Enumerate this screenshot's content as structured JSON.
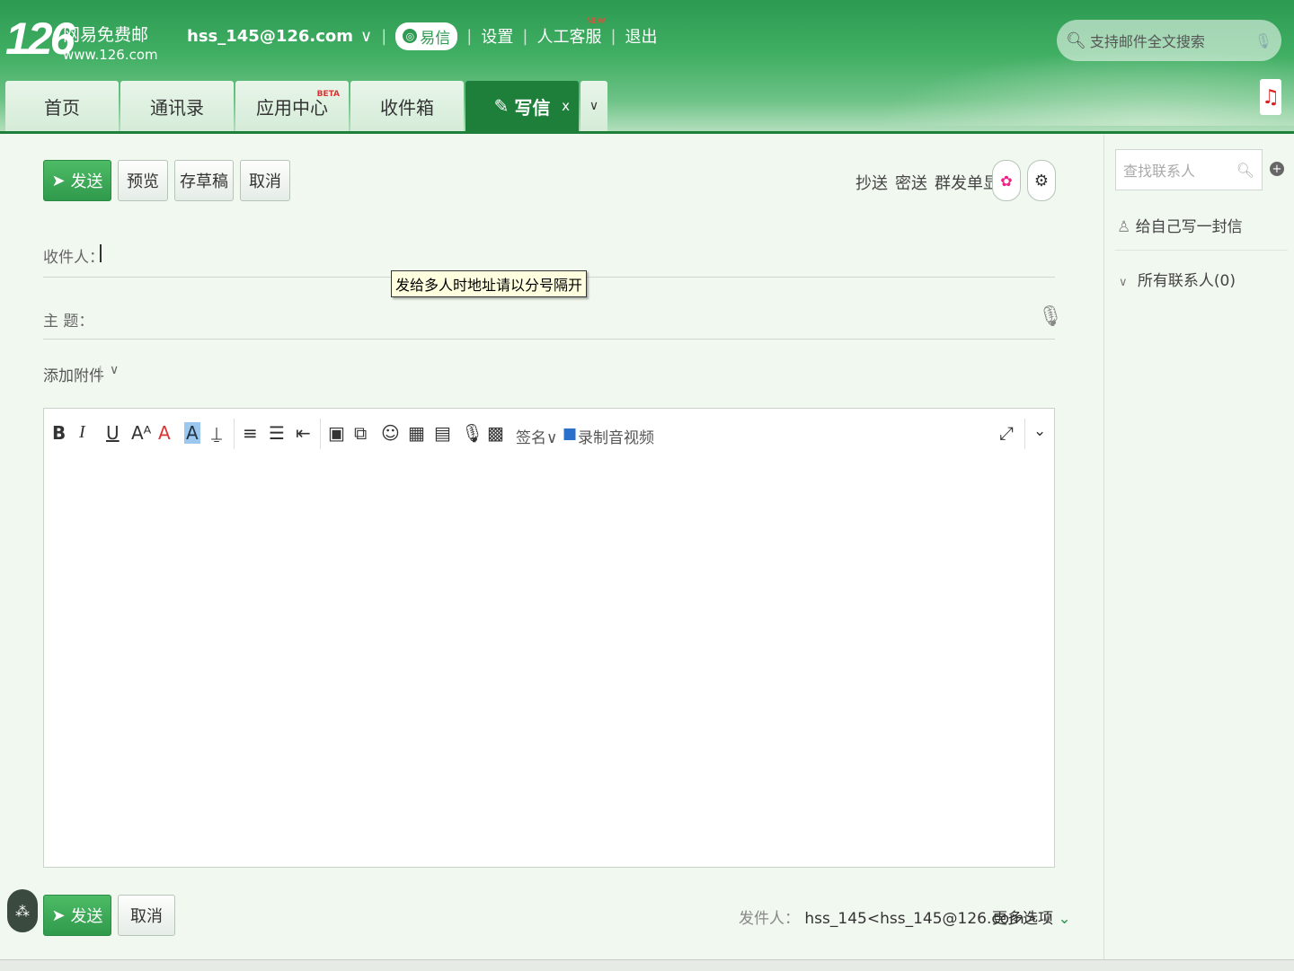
{
  "brand": {
    "number": "126",
    "name": "网易免费邮",
    "url": "www.126.com"
  },
  "topnav": {
    "account": "hss_145@126.com",
    "account_arrow": "∨",
    "yixin": "易信",
    "settings": "设置",
    "service": "人工客服",
    "service_badge": "NEW",
    "logout": "退出"
  },
  "search": {
    "placeholder": "支持邮件全文搜索"
  },
  "tabs": [
    {
      "label": "首页"
    },
    {
      "label": "通讯录"
    },
    {
      "label": "应用中心",
      "badge": "BETA"
    },
    {
      "label": "收件箱"
    },
    {
      "label": "写信",
      "close": "x"
    }
  ],
  "tabs_more": "∨",
  "compose": {
    "send": "发送",
    "preview": "预览",
    "draft": "存草稿",
    "cancel": "取消",
    "cc": "抄送",
    "bcc": "密送",
    "group_send": "群发单显",
    "to_label": "收件人：",
    "subject_label": "主  题：",
    "tooltip": "发给多人时地址请以分号隔开",
    "attach": "添加附件",
    "attach_arrow": "∨"
  },
  "editor": {
    "bold": "B",
    "italic": "I",
    "underline": "U",
    "fontsize": "Aᴬ",
    "fontcolor": "A",
    "bgcolor": "A",
    "signature": "签名∨",
    "record": "录制音视频"
  },
  "footer": {
    "send": "发送",
    "cancel": "取消",
    "sender_label": "发件人：",
    "sender_value": "hss_145<hss_145@126.com>",
    "sender_arrow": "∨",
    "more_options": "更多选项"
  },
  "contacts": {
    "search_placeholder": "查找联系人",
    "write_self": "给自己写一封信",
    "all_contacts": "所有联系人(0)"
  },
  "colors": {
    "brand_green": "#2e9a52",
    "tab_active": "#1e7f3a",
    "send_green": "#3aa957"
  }
}
